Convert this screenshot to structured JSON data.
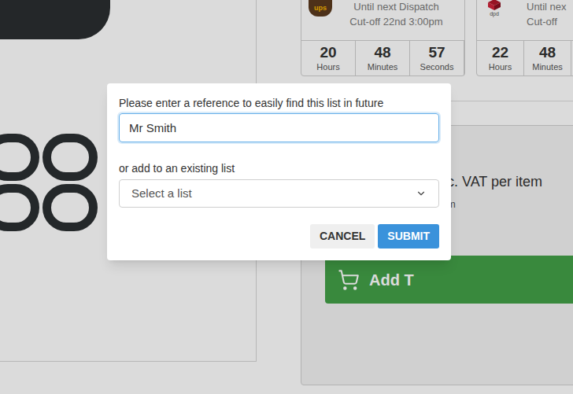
{
  "shipping": [
    {
      "carrier": "ups",
      "line1": "Until next Dispatch",
      "line2": "Cut-off 22nd 3:00pm",
      "countdown": [
        {
          "value": "20",
          "unit": "Hours"
        },
        {
          "value": "48",
          "unit": "Minutes"
        },
        {
          "value": "57",
          "unit": "Seconds"
        }
      ]
    },
    {
      "carrier": "dpd",
      "line1": "Until nex",
      "line2": "Cut-off",
      "countdown": [
        {
          "value": "22",
          "unit": "Hours"
        },
        {
          "value": "48",
          "unit": "Minutes"
        }
      ]
    }
  ],
  "price": {
    "vat_note": "c. VAT per item",
    "sub_note": "m"
  },
  "add_button": {
    "label": "Add T"
  },
  "dialog": {
    "reference_label": "Please enter a reference to easily find this list in future",
    "reference_value": "Mr Smith",
    "existing_label": "or add to an existing list",
    "select_placeholder": "Select a list",
    "buttons": [
      "CANCEL",
      "SUBMIT"
    ]
  }
}
